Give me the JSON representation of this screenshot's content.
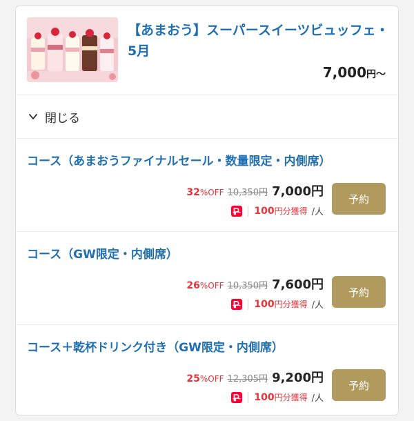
{
  "plan": {
    "title": "【あまおう】スーパースイーツビュッフェ・5月",
    "price": "7,000",
    "price_suffix": "円〜",
    "image_icon": "strawberry-dessert-photo"
  },
  "toggle": {
    "label": "閉じる",
    "icon": "chevron-down-icon"
  },
  "courses": [
    {
      "name": "コース（あまおうファイナルセール・数量限定・内側席）",
      "discount": "32",
      "off_label": "%OFF",
      "original_price": "10,350円",
      "price": "7,000円",
      "points": "100",
      "points_label": "円分獲得",
      "per_person": "/人",
      "button_label": "予約"
    },
    {
      "name": "コース（GW限定・内側席）",
      "discount": "26",
      "off_label": "%OFF",
      "original_price": "10,350円",
      "price": "7,600円",
      "points": "100",
      "points_label": "円分獲得",
      "per_person": "/人",
      "button_label": "予約"
    },
    {
      "name": "コース＋乾杯ドリンク付き（GW限定・内側席）",
      "discount": "25",
      "off_label": "%OFF",
      "original_price": "12,305円",
      "price": "9,200円",
      "points": "100",
      "points_label": "円分獲得",
      "per_person": "/人",
      "button_label": "予約"
    }
  ],
  "colors": {
    "link_blue": "#1f6fb2",
    "discount_red": "#e8333a",
    "button_gold": "#b19a5d",
    "paypay_red": "#ff0033"
  }
}
